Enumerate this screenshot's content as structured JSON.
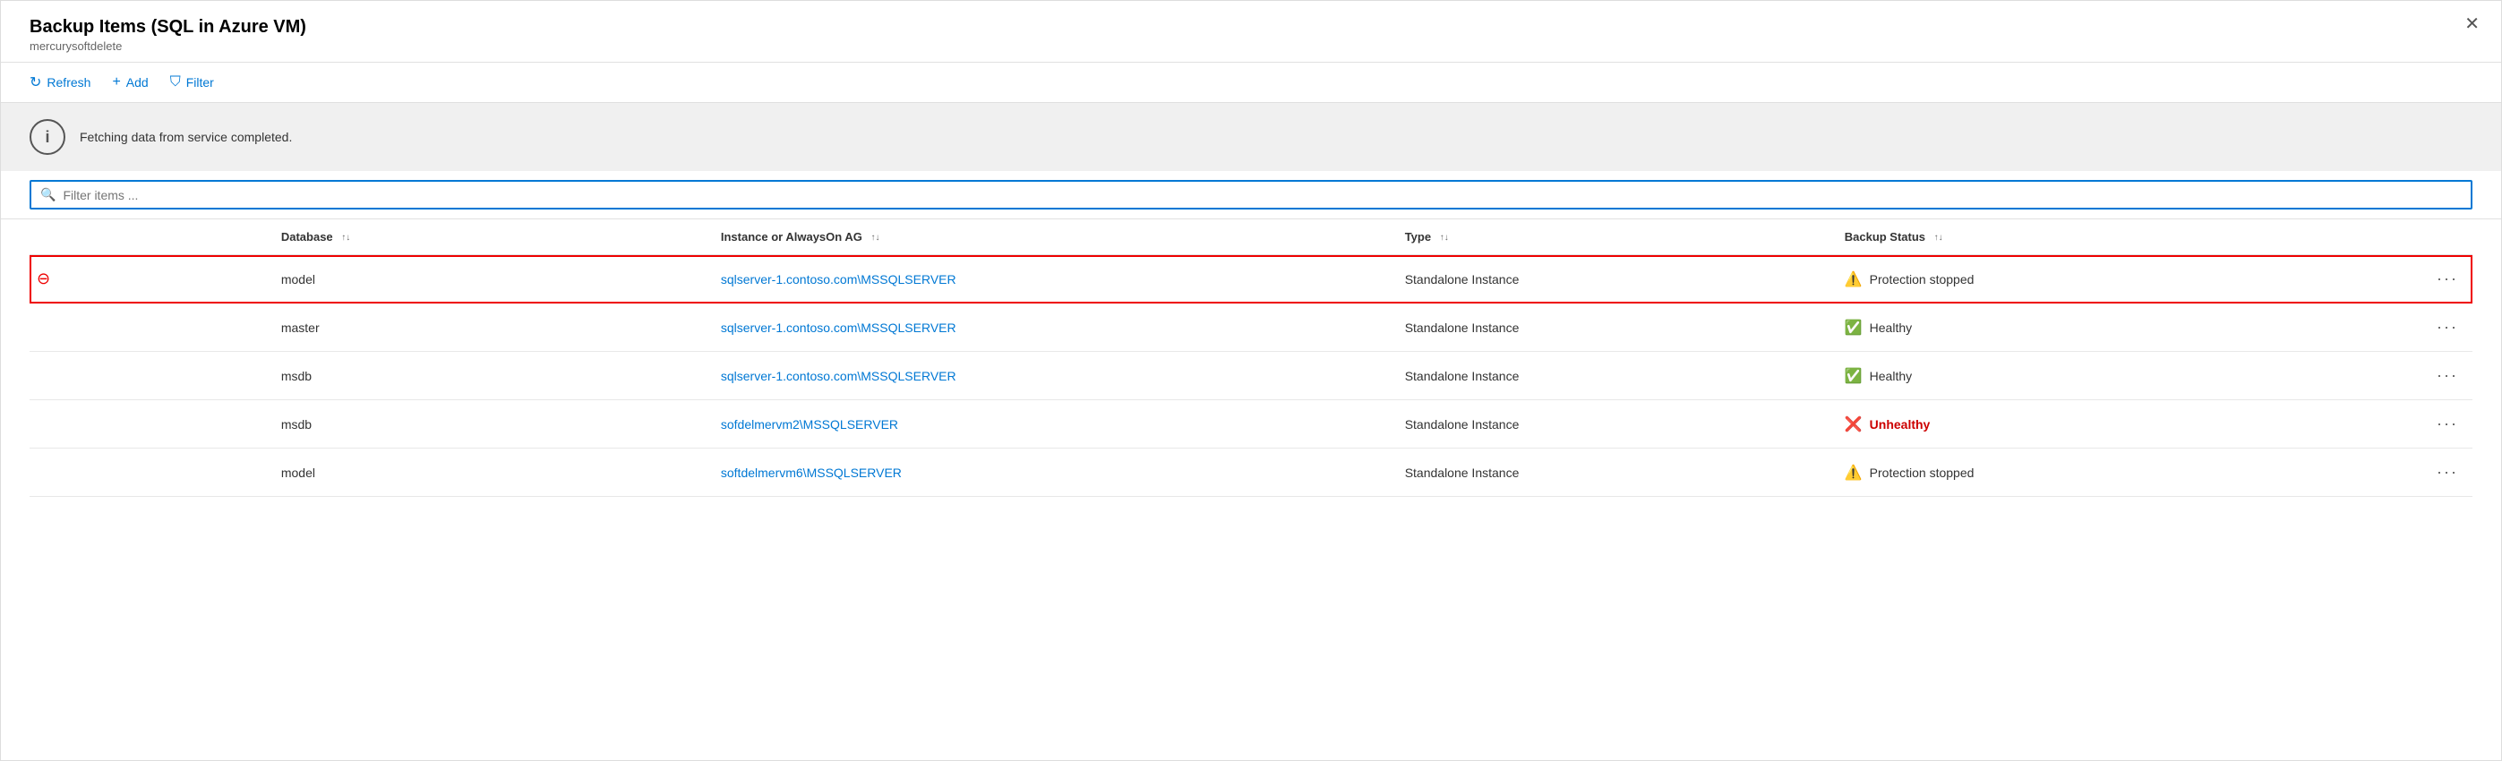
{
  "panel": {
    "title": "Backup Items (SQL in Azure VM)",
    "subtitle": "mercurysoftdelete"
  },
  "toolbar": {
    "refresh_label": "Refresh",
    "add_label": "Add",
    "filter_label": "Filter"
  },
  "banner": {
    "message": "Fetching data from service completed."
  },
  "filter": {
    "placeholder": "Filter items ..."
  },
  "table": {
    "columns": [
      {
        "id": "icon",
        "label": ""
      },
      {
        "id": "database",
        "label": "Database"
      },
      {
        "id": "instance",
        "label": "Instance or AlwaysOn AG"
      },
      {
        "id": "type",
        "label": "Type"
      },
      {
        "id": "status",
        "label": "Backup Status"
      },
      {
        "id": "more",
        "label": ""
      }
    ],
    "rows": [
      {
        "id": "row-1",
        "selected": true,
        "icon": "remove",
        "database": "model",
        "instance": "sqlserver-1.contoso.com\\MSSQLSERVER",
        "type": "Standalone Instance",
        "backup_status": "Protection stopped",
        "status_type": "warning"
      },
      {
        "id": "row-2",
        "selected": false,
        "icon": "",
        "database": "master",
        "instance": "sqlserver-1.contoso.com\\MSSQLSERVER",
        "type": "Standalone Instance",
        "backup_status": "Healthy",
        "status_type": "healthy"
      },
      {
        "id": "row-3",
        "selected": false,
        "icon": "",
        "database": "msdb",
        "instance": "sqlserver-1.contoso.com\\MSSQLSERVER",
        "type": "Standalone Instance",
        "backup_status": "Healthy",
        "status_type": "healthy"
      },
      {
        "id": "row-4",
        "selected": false,
        "icon": "",
        "database": "msdb",
        "instance": "sofdelmervm2\\MSSQLSERVER",
        "type": "Standalone Instance",
        "backup_status": "Unhealthy",
        "status_type": "error"
      },
      {
        "id": "row-5",
        "selected": false,
        "icon": "",
        "database": "model",
        "instance": "softdelmervm6\\MSSQLSERVER",
        "type": "Standalone Instance",
        "backup_status": "Protection stopped",
        "status_type": "warning"
      }
    ]
  }
}
